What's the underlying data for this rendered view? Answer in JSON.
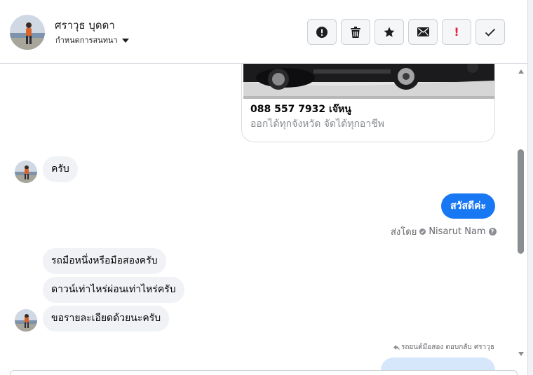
{
  "header": {
    "contact_name": "ศราวุธ บุดดา",
    "label_dropdown": "กำหนดการสนทนา",
    "actions": [
      {
        "icon": "exclamation-circle-icon"
      },
      {
        "icon": "trash-icon"
      },
      {
        "icon": "star-icon"
      },
      {
        "icon": "envelope-icon"
      },
      {
        "icon": "exclamation-icon",
        "text": "!"
      },
      {
        "icon": "checkmark-icon"
      }
    ]
  },
  "thread": {
    "ad_card": {
      "title": "088 557 7932 เจ๊หนู",
      "subtitle": "ออกได้ทุกจังหวัด จัดได้ทุกอาชีพ"
    },
    "messages": [
      {
        "from": "contact",
        "text": "ครับ"
      },
      {
        "from": "page",
        "text": "สวัสดีค่ะ"
      },
      {
        "from": "contact",
        "text": "รถมือหนึ่งหรือมือสองครับ"
      },
      {
        "from": "contact",
        "text": "ดาวน์เท่าไหร่ผ่อนเท่าไหร่ครับ"
      },
      {
        "from": "contact",
        "text": "ขอรายละเอียดด้วยนะครับ"
      }
    ],
    "sent_by_prefix": "ส่งโดย",
    "sent_by_name": "Nisarut Nam",
    "reply_note": "รถยนต์มือสอง ตอบกลับ ศราวุธ"
  },
  "colors": {
    "accent": "#1877f2",
    "incoming_bubble": "#f0f2f5",
    "danger": "#e41e3f"
  }
}
